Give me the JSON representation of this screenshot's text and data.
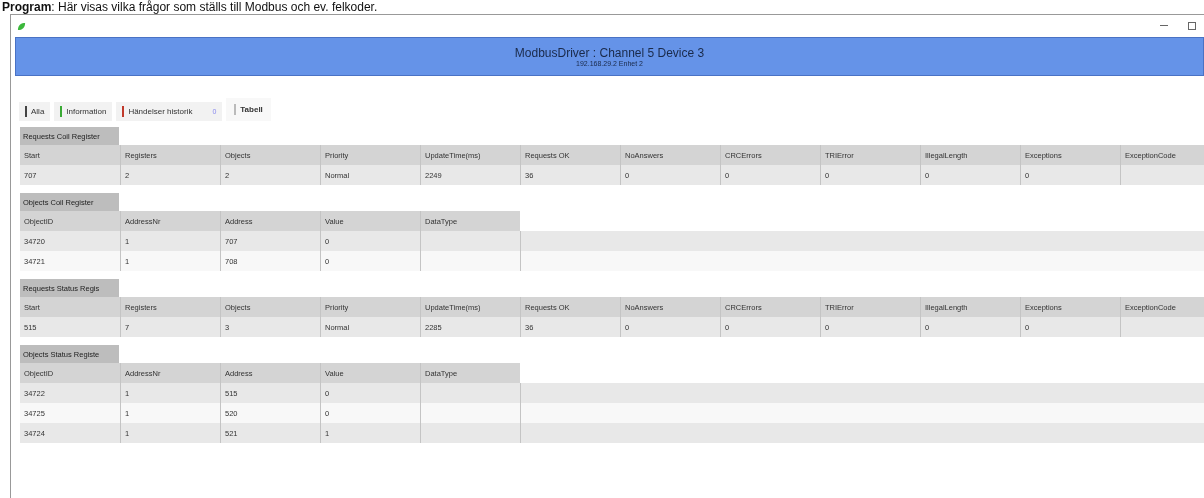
{
  "caption": "**Program**: Här visas vilka frågor som ställs till Modbus och ev. felkoder.",
  "header": {
    "title": "ModbusDriver : Channel 5 Device 3",
    "subtitle": "192.168.29.2  Enhet 2"
  },
  "tabs": [
    {
      "label": "Alla",
      "color": "#444444",
      "selected": false
    },
    {
      "label": "Information",
      "color": "#3aaa35",
      "selected": false
    },
    {
      "label": "Händelser historik",
      "color": "#c0392b",
      "badge": "0",
      "selected": false
    },
    {
      "label": "Tabell",
      "selected": true
    }
  ],
  "sections": [
    {
      "kind": "requests",
      "title": "Requests Coil Register",
      "columns": [
        "Start",
        "Registers",
        "Objects",
        "Priority",
        "UpdateTime(ms)",
        "Requests OK",
        "NoAnswers",
        "CRCErrors",
        "TRIError",
        "IllegalLength",
        "Exceptions",
        "ExceptionCode"
      ],
      "rows": [
        [
          "707",
          "2",
          "2",
          "Normal",
          "2249",
          "36",
          "0",
          "0",
          "0",
          "0",
          "0"
        ]
      ]
    },
    {
      "kind": "objects",
      "title": "Objects Coil Register",
      "columns": [
        "ObjectID",
        "AddressNr",
        "Address",
        "Value",
        "DataType"
      ],
      "rows": [
        [
          "34720",
          "1",
          "707",
          "0"
        ],
        [
          "34721",
          "1",
          "708",
          "0"
        ]
      ]
    },
    {
      "kind": "requests",
      "title": "Requests Status Regis",
      "columns": [
        "Start",
        "Registers",
        "Objects",
        "Priority",
        "UpdateTime(ms)",
        "Requests OK",
        "NoAnswers",
        "CRCErrors",
        "TRIError",
        "IllegalLength",
        "Exceptions",
        "ExceptionCode"
      ],
      "rows": [
        [
          "515",
          "7",
          "3",
          "Normal",
          "2285",
          "36",
          "0",
          "0",
          "0",
          "0",
          "0"
        ]
      ]
    },
    {
      "kind": "objects",
      "title": "Objects Status Registe",
      "columns": [
        "ObjectID",
        "AddressNr",
        "Address",
        "Value",
        "DataType"
      ],
      "rows": [
        [
          "34722",
          "1",
          "515",
          "0"
        ],
        [
          "34725",
          "1",
          "520",
          "0"
        ],
        [
          "34724",
          "1",
          "521",
          "1"
        ]
      ]
    }
  ]
}
